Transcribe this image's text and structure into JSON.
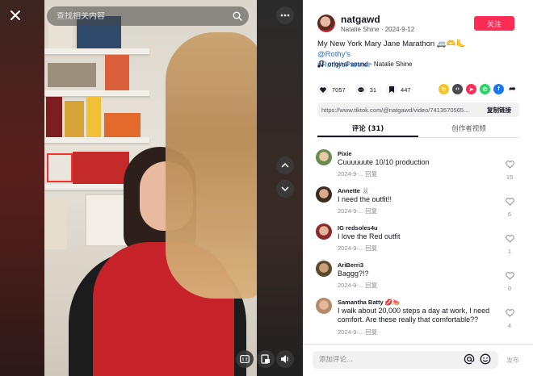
{
  "video": {
    "search_placeholder": "查找相关内容"
  },
  "author": {
    "username": "natgawd",
    "display_name": "Natalie Shine",
    "date": "2024-9-12",
    "follow_label": "关注"
  },
  "caption": {
    "text": "My New York Mary Jane Marathon 🚐🫶🦶",
    "mention": "@Rothy's",
    "hashtag": "#RothysPartner",
    "sound": "original sound - Natalie Shine"
  },
  "stats": {
    "likes": "7057",
    "comments": "31",
    "saves": "447"
  },
  "share": {
    "link": "https://www.tiktok.com/@natgawd/video/7413570565...",
    "copy_label": "复制链接"
  },
  "tabs": {
    "comments": "评论 (31)",
    "creator_videos": "创作者视频"
  },
  "comments": [
    {
      "user": "Pixie",
      "text": "Cuuuuuute 10/10 production",
      "date": "2024-9-...",
      "reply": "回复",
      "likes": "15"
    },
    {
      "user": "Annette 🐰",
      "text": "I need the outfit!!",
      "date": "2024-9-...",
      "reply": "回复",
      "likes": "6"
    },
    {
      "user": "IG redsoles4u",
      "text": "I love the Red outfit",
      "date": "2024-9-...",
      "reply": "回复",
      "likes": "1"
    },
    {
      "user": "AriBerri3",
      "text": "Baggg?!?",
      "date": "2024-9-...",
      "reply": "回复",
      "likes": "0"
    },
    {
      "user": "Samantha Batty 💋🍉",
      "text": "I walk about 20,000 steps a day at work, I need comfort. Are these really that comfortable??",
      "date": "2024-9-...",
      "reply": "回复",
      "likes": "4"
    }
  ],
  "input": {
    "placeholder": "添加评论...",
    "post_label": "发布"
  },
  "colors": {
    "accent": "#fe2c55",
    "link": "#2a6fd6"
  }
}
